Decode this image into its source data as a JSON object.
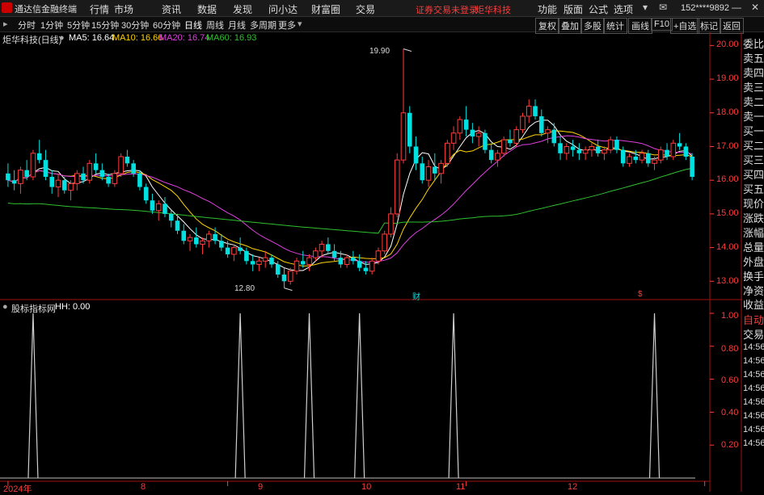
{
  "app": {
    "title": "通达信金融终端",
    "menus": [
      "行情",
      "市场",
      "资讯",
      "数据",
      "发现",
      "问小达",
      "财富圈",
      "交易"
    ],
    "status_not_logged": "证券交易未登录",
    "stock_name_top": "炬华科技",
    "right_menus": [
      "功能",
      "版面",
      "公式",
      "选项"
    ],
    "account": "152****9892"
  },
  "toolbar": {
    "periods": [
      "分时",
      "1分钟",
      "5分钟",
      "15分钟",
      "30分钟",
      "60分钟",
      "日线",
      "周线",
      "月线",
      "多周期",
      "更多"
    ],
    "active_period": "日线",
    "right_buttons": [
      "复权",
      "叠加",
      "多股",
      "统计",
      "画线",
      "F10",
      "+自选",
      "标记",
      "返回"
    ]
  },
  "main_chart": {
    "title": "炬华科技(日线)",
    "ma5": "MA5: 16.64",
    "ma10": "MA10: 16.66",
    "ma20": "MA20: 16.74",
    "ma60": "MA60: 16.93",
    "colors": {
      "ma5": "#ffffff",
      "ma10": "#ffd400",
      "ma20": "#e040e0",
      "ma60": "#30c030",
      "up": "#ff3c3c",
      "down": "#00e0e0"
    },
    "high_label": "19.90",
    "low_label": "12.80",
    "event_marks": [
      "财",
      "$"
    ]
  },
  "sub_chart": {
    "title": "股标指标网",
    "hh": "HH: 0.00"
  },
  "right_panel": {
    "labels": [
      "委比",
      "卖五",
      "卖四",
      "卖三",
      "卖二",
      "卖一",
      "买一",
      "买二",
      "买三",
      "买四",
      "买五",
      "现价",
      "涨跌",
      "涨幅",
      "总量",
      "外盘",
      "换手",
      "净资",
      "收益"
    ],
    "auto_label": "自动",
    "trade_label": "交易",
    "times": [
      "14:56",
      "14:56",
      "14:56",
      "14:56",
      "14:56",
      "14:56",
      "14:56",
      "14:56"
    ]
  },
  "chart_data": [
    {
      "type": "candlestick",
      "title": "炬华科技(日线)",
      "ylim": [
        12.6,
        20.2
      ],
      "y_ticks": [
        20.0,
        19.0,
        18.0,
        17.0,
        16.0,
        15.0,
        14.0,
        13.0
      ],
      "x_labels": [
        "2024年",
        "8",
        "9",
        "10",
        "11",
        "12"
      ],
      "x_label_index": [
        0,
        35,
        73,
        111,
        148,
        185
      ],
      "candles": [
        [
          16.2,
          16.5,
          15.8,
          16.0
        ],
        [
          16.0,
          16.3,
          15.7,
          15.9
        ],
        [
          15.9,
          16.4,
          15.6,
          16.3
        ],
        [
          16.3,
          16.6,
          16.0,
          16.1
        ],
        [
          16.1,
          16.9,
          16.0,
          16.8
        ],
        [
          16.8,
          17.2,
          16.5,
          16.6
        ],
        [
          16.6,
          16.9,
          16.0,
          16.1
        ],
        [
          16.1,
          16.3,
          15.6,
          15.8
        ],
        [
          15.8,
          16.2,
          15.5,
          16.0
        ],
        [
          16.0,
          16.1,
          15.6,
          15.7
        ],
        [
          15.7,
          16.0,
          15.4,
          15.9
        ],
        [
          15.9,
          16.3,
          15.7,
          16.2
        ],
        [
          16.2,
          16.4,
          15.9,
          16.0
        ],
        [
          16.0,
          16.6,
          15.9,
          16.5
        ],
        [
          16.5,
          16.8,
          16.2,
          16.3
        ],
        [
          16.3,
          16.5,
          16.0,
          16.1
        ],
        [
          16.1,
          16.2,
          15.8,
          15.9
        ],
        [
          15.9,
          16.3,
          15.8,
          16.2
        ],
        [
          16.2,
          16.8,
          16.1,
          16.7
        ],
        [
          16.7,
          16.9,
          16.4,
          16.5
        ],
        [
          16.5,
          16.6,
          16.1,
          16.2
        ],
        [
          16.2,
          16.3,
          15.7,
          15.8
        ],
        [
          15.8,
          15.9,
          15.3,
          15.4
        ],
        [
          15.4,
          15.6,
          15.0,
          15.1
        ],
        [
          15.1,
          15.4,
          14.8,
          15.3
        ],
        [
          15.3,
          15.5,
          14.9,
          15.0
        ],
        [
          15.0,
          15.1,
          14.6,
          14.8
        ],
        [
          14.8,
          15.0,
          14.4,
          14.5
        ],
        [
          14.5,
          14.7,
          14.1,
          14.2
        ],
        [
          14.2,
          14.4,
          13.9,
          14.3
        ],
        [
          14.3,
          14.6,
          14.0,
          14.1
        ],
        [
          14.1,
          14.3,
          13.8,
          14.2
        ],
        [
          14.2,
          14.5,
          14.0,
          14.4
        ],
        [
          14.4,
          14.6,
          14.1,
          14.2
        ],
        [
          14.2,
          14.4,
          13.9,
          14.0
        ],
        [
          14.0,
          14.2,
          13.7,
          13.8
        ],
        [
          13.8,
          14.1,
          13.6,
          14.0
        ],
        [
          14.0,
          14.3,
          13.8,
          13.9
        ],
        [
          13.9,
          14.0,
          13.5,
          13.6
        ],
        [
          13.6,
          13.8,
          13.3,
          13.5
        ],
        [
          13.5,
          13.7,
          13.3,
          13.6
        ],
        [
          13.6,
          13.9,
          13.4,
          13.7
        ],
        [
          13.7,
          13.8,
          13.4,
          13.5
        ],
        [
          13.5,
          13.6,
          13.1,
          13.2
        ],
        [
          13.2,
          13.4,
          12.8,
          13.0
        ],
        [
          13.0,
          13.4,
          12.9,
          13.3
        ],
        [
          13.3,
          13.7,
          13.2,
          13.6
        ],
        [
          13.6,
          13.9,
          13.4,
          13.5
        ],
        [
          13.5,
          13.8,
          13.3,
          13.7
        ],
        [
          13.7,
          14.0,
          13.6,
          13.9
        ],
        [
          13.9,
          14.2,
          13.7,
          14.1
        ],
        [
          14.1,
          14.3,
          13.8,
          13.9
        ],
        [
          13.9,
          14.1,
          13.6,
          13.7
        ],
        [
          13.7,
          13.9,
          13.4,
          13.5
        ],
        [
          13.5,
          13.8,
          13.4,
          13.7
        ],
        [
          13.7,
          13.9,
          13.5,
          13.6
        ],
        [
          13.6,
          13.8,
          13.3,
          13.4
        ],
        [
          13.4,
          13.6,
          13.2,
          13.3
        ],
        [
          13.3,
          13.7,
          13.2,
          13.6
        ],
        [
          13.6,
          14.0,
          13.5,
          13.9
        ],
        [
          13.9,
          14.5,
          13.8,
          14.4
        ],
        [
          14.4,
          15.2,
          14.3,
          15.0
        ],
        [
          15.0,
          16.8,
          14.9,
          16.6
        ],
        [
          16.6,
          19.9,
          16.5,
          18.0
        ],
        [
          18.0,
          18.2,
          16.8,
          17.0
        ],
        [
          17.0,
          17.3,
          16.3,
          16.5
        ],
        [
          16.5,
          16.7,
          15.9,
          16.0
        ],
        [
          16.0,
          16.6,
          15.8,
          16.4
        ],
        [
          16.4,
          16.8,
          16.0,
          16.2
        ],
        [
          16.2,
          16.6,
          15.9,
          16.5
        ],
        [
          16.5,
          17.2,
          16.4,
          17.1
        ],
        [
          17.1,
          17.6,
          16.9,
          17.4
        ],
        [
          17.4,
          17.9,
          17.2,
          17.8
        ],
        [
          17.8,
          18.2,
          17.3,
          17.5
        ],
        [
          17.5,
          17.7,
          17.1,
          17.3
        ],
        [
          17.3,
          17.6,
          17.0,
          17.4
        ],
        [
          17.4,
          17.5,
          16.8,
          16.9
        ],
        [
          16.9,
          17.1,
          16.5,
          16.6
        ],
        [
          16.6,
          16.9,
          16.4,
          16.8
        ],
        [
          16.8,
          17.3,
          16.7,
          17.2
        ],
        [
          17.2,
          17.5,
          17.0,
          17.1
        ],
        [
          17.1,
          17.6,
          17.0,
          17.5
        ],
        [
          17.5,
          18.0,
          17.4,
          17.9
        ],
        [
          17.9,
          18.4,
          17.7,
          18.2
        ],
        [
          18.2,
          18.4,
          17.8,
          17.9
        ],
        [
          17.9,
          18.1,
          17.3,
          17.4
        ],
        [
          17.4,
          17.6,
          17.1,
          17.5
        ],
        [
          17.5,
          17.7,
          17.0,
          17.1
        ],
        [
          17.1,
          17.3,
          16.6,
          16.8
        ],
        [
          16.8,
          17.1,
          16.6,
          17.0
        ],
        [
          17.0,
          17.2,
          16.7,
          16.9
        ],
        [
          16.9,
          17.1,
          16.6,
          16.8
        ],
        [
          16.8,
          17.0,
          16.6,
          16.9
        ],
        [
          16.9,
          17.1,
          16.7,
          17.0
        ],
        [
          17.0,
          17.2,
          16.7,
          16.8
        ],
        [
          16.8,
          17.0,
          16.6,
          16.9
        ],
        [
          16.9,
          17.3,
          16.8,
          17.2
        ],
        [
          17.2,
          17.3,
          16.8,
          16.9
        ],
        [
          16.9,
          17.0,
          16.4,
          16.5
        ],
        [
          16.5,
          16.8,
          16.4,
          16.7
        ],
        [
          16.7,
          16.9,
          16.5,
          16.6
        ],
        [
          16.6,
          16.9,
          16.5,
          16.8
        ],
        [
          16.8,
          16.9,
          16.4,
          16.5
        ],
        [
          16.5,
          16.7,
          16.3,
          16.6
        ],
        [
          16.6,
          17.0,
          16.5,
          16.9
        ],
        [
          16.9,
          17.1,
          16.6,
          16.7
        ],
        [
          16.7,
          17.2,
          16.6,
          17.1
        ],
        [
          17.1,
          17.4,
          16.9,
          17.0
        ],
        [
          17.0,
          17.1,
          16.6,
          16.7
        ],
        [
          16.7,
          16.8,
          16.0,
          16.1
        ]
      ]
    },
    {
      "type": "line",
      "title": "股标指标网",
      "ylim": [
        0,
        1.0
      ],
      "y_ticks": [
        1.0,
        0.8,
        0.6,
        0.4,
        0.2
      ],
      "spike_index": [
        4,
        37,
        48,
        56,
        71,
        103,
        171,
        192,
        198
      ]
    }
  ]
}
